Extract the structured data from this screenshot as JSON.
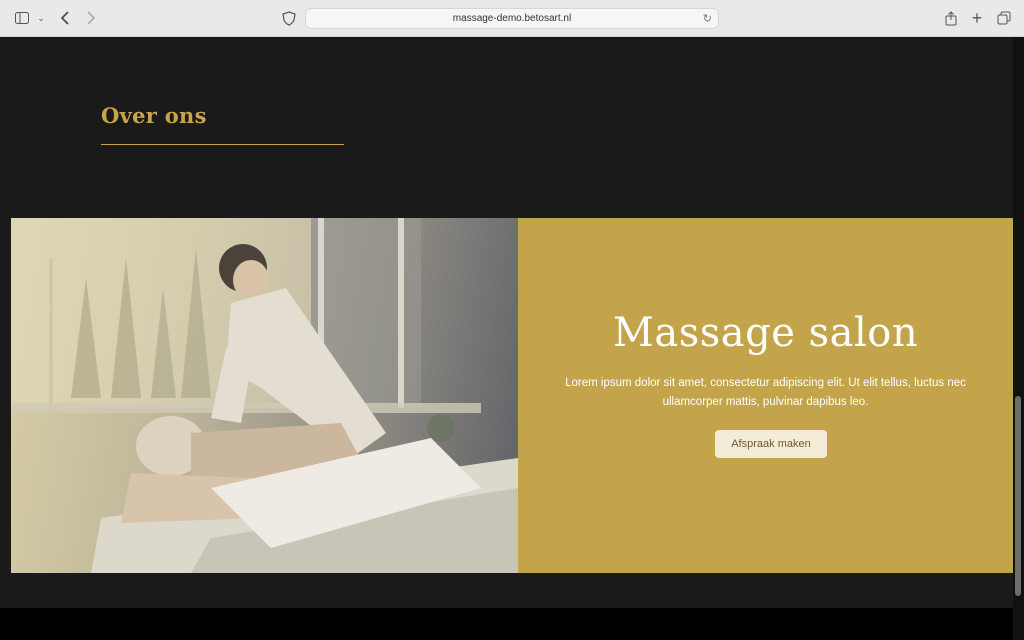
{
  "browser": {
    "url": "massage-demo.betosart.nl",
    "icons": [
      "sidebar-icon",
      "chevron-down-icon",
      "back-icon",
      "forward-icon",
      "shield-icon",
      "reload-icon",
      "share-icon",
      "plus-icon",
      "tabs-icon"
    ]
  },
  "section": {
    "heading": "Over ons",
    "accent_color": "#c9a54a"
  },
  "hero": {
    "image_alt": "massage photo",
    "title": "Massage salon",
    "text": "Lorem ipsum dolor sit amet, consectetur adipiscing elit. Ut elit tellus, luctus nec ullamcorper mattis, pulvinar dapibus leo.",
    "button_label": "Afspraak maken",
    "panel_color": "#c4a44b"
  }
}
